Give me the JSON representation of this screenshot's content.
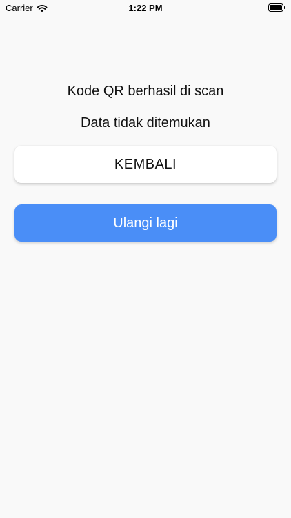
{
  "status_bar": {
    "carrier": "Carrier",
    "time": "1:22 PM",
    "wifi_icon": "wifi-icon",
    "battery_icon": "battery-full-icon"
  },
  "messages": {
    "scan_result": "Kode QR berhasil di scan",
    "not_found": "Data tidak ditemukan"
  },
  "buttons": {
    "back_label": "KEMBALI",
    "retry_label": "Ulangi lagi"
  },
  "colors": {
    "background": "#f9f9f9",
    "primary_button": "#4a8ef7",
    "secondary_button": "#ffffff"
  }
}
